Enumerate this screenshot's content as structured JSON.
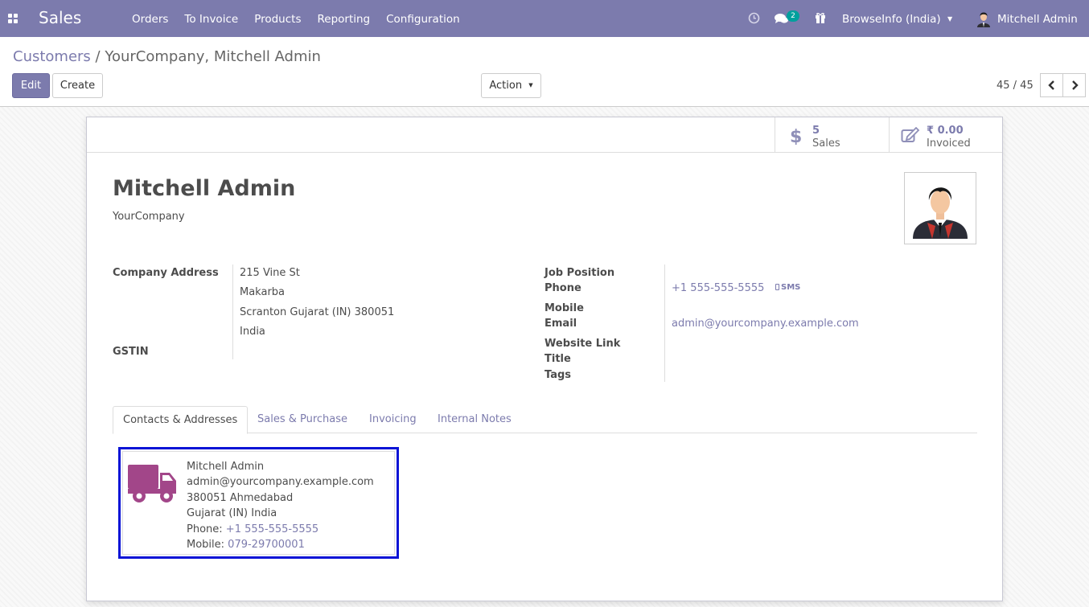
{
  "navbar": {
    "app_name": "Sales",
    "menu": [
      "Orders",
      "To Invoice",
      "Products",
      "Reporting",
      "Configuration"
    ],
    "messages_badge": "2",
    "company": "BrowseInfo (India)",
    "user": "Mitchell Admin"
  },
  "control_panel": {
    "breadcrumb_parent": "Customers",
    "breadcrumb_separator": "/",
    "breadcrumb_current": "YourCompany, Mitchell Admin",
    "edit_label": "Edit",
    "create_label": "Create",
    "action_label": "Action",
    "pager": "45 / 45"
  },
  "stat_buttons": {
    "sales_value": "5",
    "sales_label": "Sales",
    "invoiced_value": "₹ 0.00",
    "invoiced_label": "Invoiced"
  },
  "partner": {
    "name": "Mitchell Admin",
    "parent_company": "YourCompany"
  },
  "fields": {
    "company_address_label": "Company Address",
    "street": "215 Vine St",
    "street2": "Makarba",
    "city_line": "Scranton  Gujarat (IN)  380051",
    "country": "India",
    "gstin_label": "GSTIN",
    "job_position_label": "Job Position",
    "phone_label": "Phone",
    "phone_value": "+1 555-555-5555",
    "sms_label": "SMS",
    "mobile_label": "Mobile",
    "email_label": "Email",
    "email_value": "admin@yourcompany.example.com",
    "website_label": "Website Link",
    "title_label": "Title",
    "tags_label": "Tags"
  },
  "tabs": [
    "Contacts & Addresses",
    "Sales & Purchase",
    "Invoicing",
    "Internal Notes"
  ],
  "contact_card": {
    "name": "Mitchell Admin",
    "email": "admin@yourcompany.example.com",
    "address_line1": "380051 Ahmedabad",
    "address_line2": "Gujarat (IN) India",
    "phone_label": "Phone:",
    "phone": "+1 555-555-5555",
    "mobile_label": "Mobile:",
    "mobile": "079-29700001",
    "icon": "delivery-truck-icon",
    "icon_color": "#a24689"
  },
  "colors": {
    "brand": "#7c7bad",
    "highlight_border": "#0b14d6",
    "badge": "#00a09d"
  }
}
